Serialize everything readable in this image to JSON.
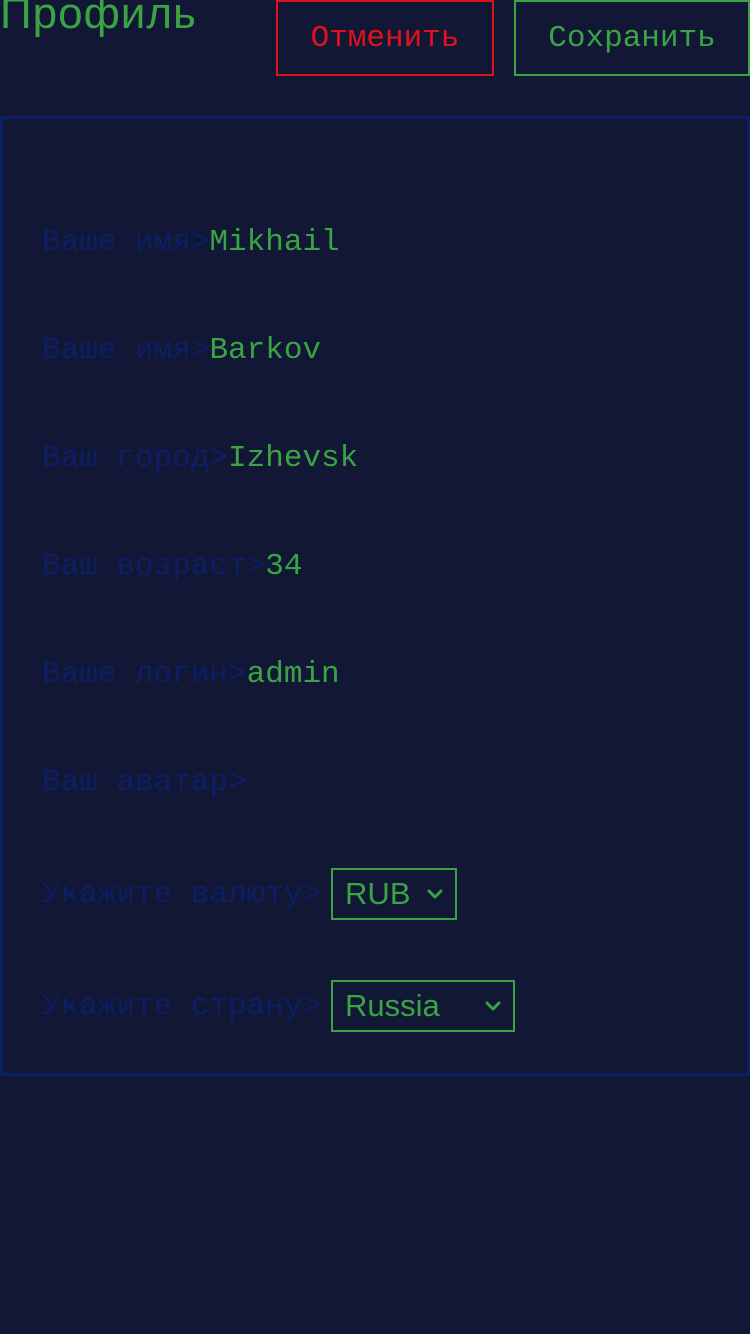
{
  "header": {
    "title": "Профиль",
    "cancel_label": "Отменить",
    "save_label": "Сохранить"
  },
  "form": {
    "first_name": {
      "label": "Ваше имя>",
      "value": "Mikhail"
    },
    "last_name": {
      "label": "Ваше имя>",
      "value": "Barkov"
    },
    "city": {
      "label": "Ваш город>",
      "value": "Izhevsk"
    },
    "age": {
      "label": "Ваш возраст>",
      "value": "34"
    },
    "login": {
      "label": "Ваше логин>",
      "value": "admin"
    },
    "avatar": {
      "label": "Ваш аватар>"
    },
    "currency": {
      "label": "Укажите валюту>",
      "selected": "RUB"
    },
    "country": {
      "label": "Укажите страну>",
      "selected": "Russia"
    }
  },
  "colors": {
    "background": "#111735",
    "accent_green": "#3aa444",
    "cancel_red": "#e0121b",
    "label_blue": "#0c1f66",
    "panel_border": "#0b1f66"
  },
  "icons": {
    "select_chevron": "chevron-down-icon"
  }
}
